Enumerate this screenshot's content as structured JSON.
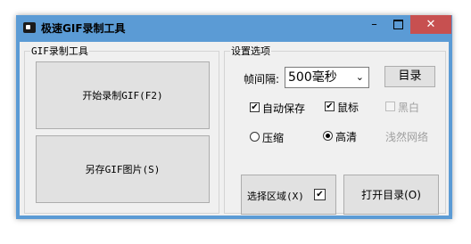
{
  "window": {
    "title": "极速GIF录制工具",
    "minimize": "–",
    "close": "✕",
    "accent": "#5b9bd5",
    "close_color": "#c75050"
  },
  "left_group": {
    "legend": "GIF录制工具",
    "record_button": "开始录制GIF(F2)",
    "save_button": "另存GIF图片(S)"
  },
  "settings": {
    "legend": "设置选项",
    "interval_label": "帧间隔:",
    "interval_value": "500毫秒",
    "dir_button": "目录",
    "autosave_label": "自动保存",
    "autosave_checked": true,
    "mouse_label": "鼠标",
    "mouse_checked": true,
    "bw_label": "黑白",
    "bw_checked": false,
    "compress_label": "压缩",
    "compress_selected": false,
    "hd_label": "高清",
    "hd_selected": true,
    "brand_text": "浅然网络",
    "region_button": "选择区域(X)",
    "region_checked": true,
    "open_dir_button": "打开目录(O)"
  }
}
